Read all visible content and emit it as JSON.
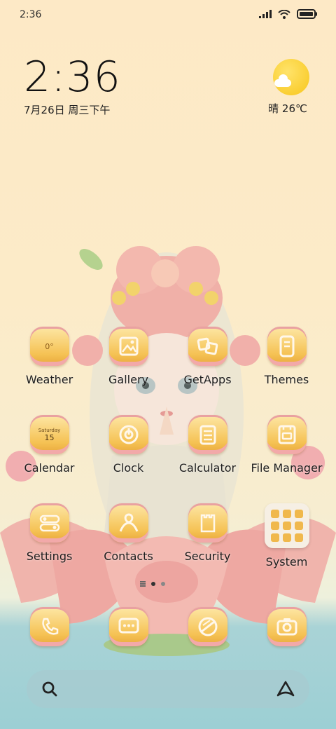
{
  "status_bar": {
    "time": "2:36"
  },
  "clock_widget": {
    "time": "2:36",
    "date": "7月26日 周三下午"
  },
  "weather_widget": {
    "text": "晴 26℃"
  },
  "apps": {
    "row1": [
      {
        "label": "Weather",
        "icon": "weather-icon",
        "sub": "0°"
      },
      {
        "label": "Gallery",
        "icon": "gallery-icon"
      },
      {
        "label": "GetApps",
        "icon": "getapps-icon"
      },
      {
        "label": "Themes",
        "icon": "themes-icon"
      }
    ],
    "row2": [
      {
        "label": "Calendar",
        "icon": "calendar-icon",
        "sub_day": "Saturday",
        "sub_date": "15"
      },
      {
        "label": "Clock",
        "icon": "clock-icon"
      },
      {
        "label": "Calculator",
        "icon": "calculator-icon"
      },
      {
        "label": "File Manager",
        "icon": "file-manager-icon"
      }
    ],
    "row3": [
      {
        "label": "Settings",
        "icon": "settings-icon"
      },
      {
        "label": "Contacts",
        "icon": "contacts-icon"
      },
      {
        "label": "Security",
        "icon": "security-icon"
      },
      {
        "label": "System",
        "icon": "system-folder-icon"
      }
    ]
  },
  "dock": [
    "phone-icon",
    "messages-icon",
    "browser-icon",
    "camera-icon"
  ],
  "colors": {
    "icon_gold": "#f5c254",
    "icon_pink": "#f2a9a9",
    "icon_line": "#fff7ea"
  }
}
